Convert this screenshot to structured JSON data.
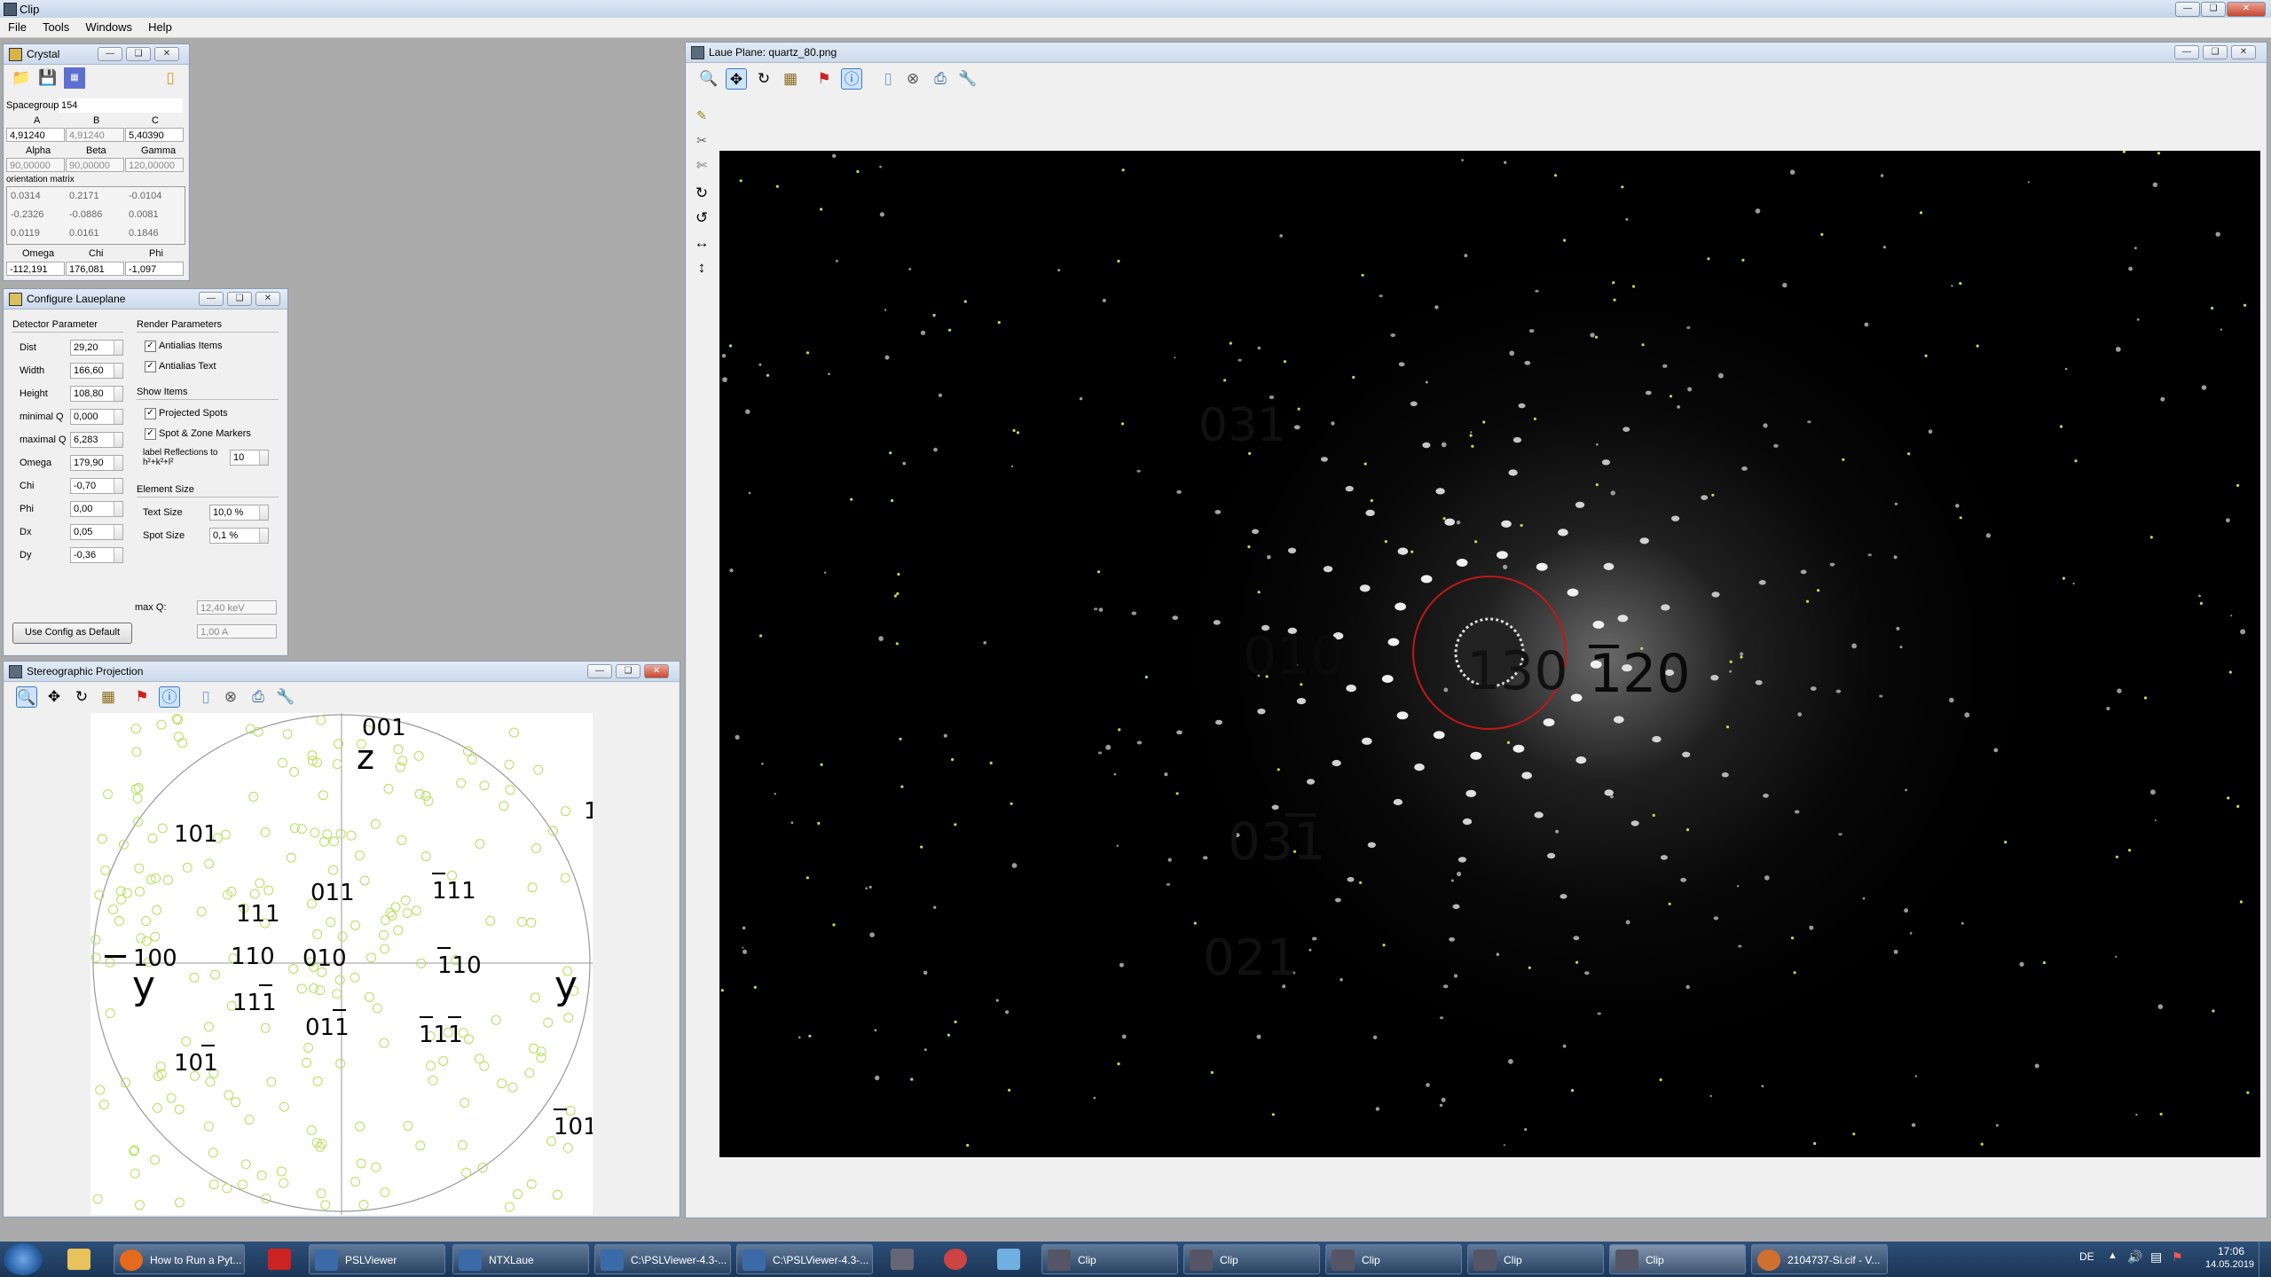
{
  "app": {
    "title": "Clip",
    "menus": [
      "File",
      "Tools",
      "Windows",
      "Help"
    ]
  },
  "crystal": {
    "title": "Crystal",
    "spacegroup_label": "Spacegroup",
    "spacegroup": "154",
    "abc_headers": [
      "A",
      "B",
      "C"
    ],
    "abc": [
      "4,91240",
      "4,91240",
      "5,40390"
    ],
    "angle_headers": [
      "Alpha",
      "Beta",
      "Gamma"
    ],
    "angles": [
      "90,00000",
      "90,00000",
      "120,00000"
    ],
    "orientation_label": "orientation matrix",
    "matrix": [
      [
        "0.0314",
        "0.2171",
        "-0.0104"
      ],
      [
        "-0.2326",
        "-0.0886",
        "0.0081"
      ],
      [
        "0.0119",
        "0.0161",
        "0.1846"
      ]
    ],
    "ocp_headers": [
      "Omega",
      "Chi",
      "Phi"
    ],
    "ocp": [
      "-112,191",
      "176,081",
      "-1,097"
    ]
  },
  "config": {
    "title": "Configure Laueplane",
    "detector_title": "Detector Parameter",
    "params": [
      {
        "label": "Dist",
        "value": "29,20"
      },
      {
        "label": "Width",
        "value": "166,60"
      },
      {
        "label": "Height",
        "value": "108,80"
      },
      {
        "label": "minimal Q",
        "value": "0,000"
      },
      {
        "label": "maximal Q",
        "value": "6,283"
      },
      {
        "label": "Omega",
        "value": "179,90"
      },
      {
        "label": "Chi",
        "value": "-0,70"
      },
      {
        "label": "Phi",
        "value": "0,00"
      },
      {
        "label": "Dx",
        "value": "0,05"
      },
      {
        "label": "Dy",
        "value": "-0,36"
      }
    ],
    "render_title": "Render Parameters",
    "antialias_items": "Antialias Items",
    "antialias_text": "Antialias Text",
    "show_title": "Show Items",
    "projected_spots": "Projected Spots",
    "spot_zone": "Spot & Zone Markers",
    "label_refl": "label Reflections to",
    "label_refl2": "h²+k²+l²",
    "label_refl_value": "10",
    "element_title": "Element Size",
    "text_size_label": "Text Size",
    "text_size": "10,0 %",
    "spot_size_label": "Spot Size",
    "spot_size": "0,1 %",
    "maxq_label": "max Q:",
    "maxq_kev": "12,40 keV",
    "maxq_a": "1,00 A",
    "default_button": "Use Config as Default"
  },
  "stereo": {
    "title": "Stereographic Projection",
    "labels": {
      "l001": "001",
      "z": "z",
      "l101": "101",
      "l011": "011",
      "l111a": "111",
      "l111b": "111",
      "l100": "100",
      "l110": "110",
      "l010": "010",
      "l110b": "110",
      "y1": "y",
      "y2": "y",
      "l111c": "111",
      "l011b": "011",
      "l111d": "111",
      "l101b": "101",
      "l101c": "101",
      "l1": "1"
    }
  },
  "laue": {
    "title": "Laue Plane: quartz_80.png",
    "labels": {
      "l031": "031",
      "l010": "010",
      "l130": "130",
      "l120": "120",
      "l031b": "031",
      "l021": "021"
    }
  },
  "taskbar": {
    "items": [
      "How to Run a Pyt...",
      "PSLViewer",
      "NTXLaue",
      "C:\\PSLViewer-4.3-...",
      "C:\\PSLViewer-4.3-...",
      "Clip",
      "Clip",
      "Clip",
      "Clip",
      "Clip",
      "2104737-Si.cif - V..."
    ],
    "lang": "DE",
    "time": "17:06",
    "date": "14.05.2019"
  }
}
